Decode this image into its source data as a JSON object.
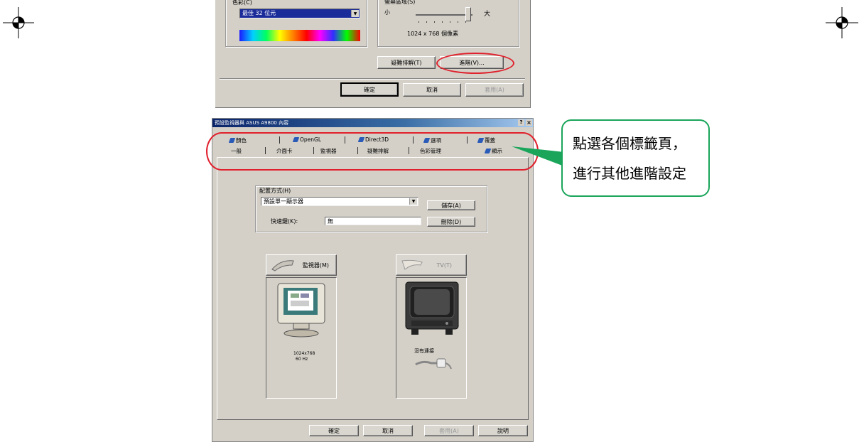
{
  "top_dialog": {
    "color_label": "色彩(C)",
    "color_value": "最佳 32 位元",
    "resolution_label": "螢幕區域(S)",
    "slider_min": "小",
    "slider_max": "大",
    "resolution_value": "1024 x 768 個像素",
    "troubleshoot_button": "疑難排解(T)",
    "advanced_button": "進階(V)...",
    "ok_button": "確定",
    "cancel_button": "取消",
    "apply_button": "套用(A)"
  },
  "props_dialog": {
    "title": "預設監視器與 ASUS A9800 內容",
    "title_buttons": [
      "?",
      "×"
    ],
    "tabs_row1": [
      "顏色",
      "OpenGL",
      "Direct3D",
      "選項",
      "覆蓋"
    ],
    "tabs_row2": [
      "一般",
      "介面卡",
      "監視器",
      "疑難排解",
      "色彩管理",
      "顯示"
    ],
    "scheme_label": "配置方式(H)",
    "scheme_value": "預設單一顯示器",
    "save_button": "儲存(A)",
    "hotkey_label": "快速鍵(K):",
    "hotkey_value": "無",
    "delete_button": "刪除(D)",
    "monitor_button": "監視器(M)",
    "monitor_info_line1": "1024x768",
    "monitor_info_line2": "60 Hz",
    "tv_button": "TV(T)",
    "tv_status": "沒有連接",
    "ok_button": "確定",
    "cancel_button": "取消",
    "apply_button": "套用(A)",
    "help_button": "說明"
  },
  "callout": {
    "line1": "點選各個標籤頁，",
    "line2": "進行其他進階設定"
  },
  "colors": {
    "dialog_bg": "#d4d0c8",
    "highlight_red": "#e0202c",
    "callout_green": "#1aa55a"
  }
}
